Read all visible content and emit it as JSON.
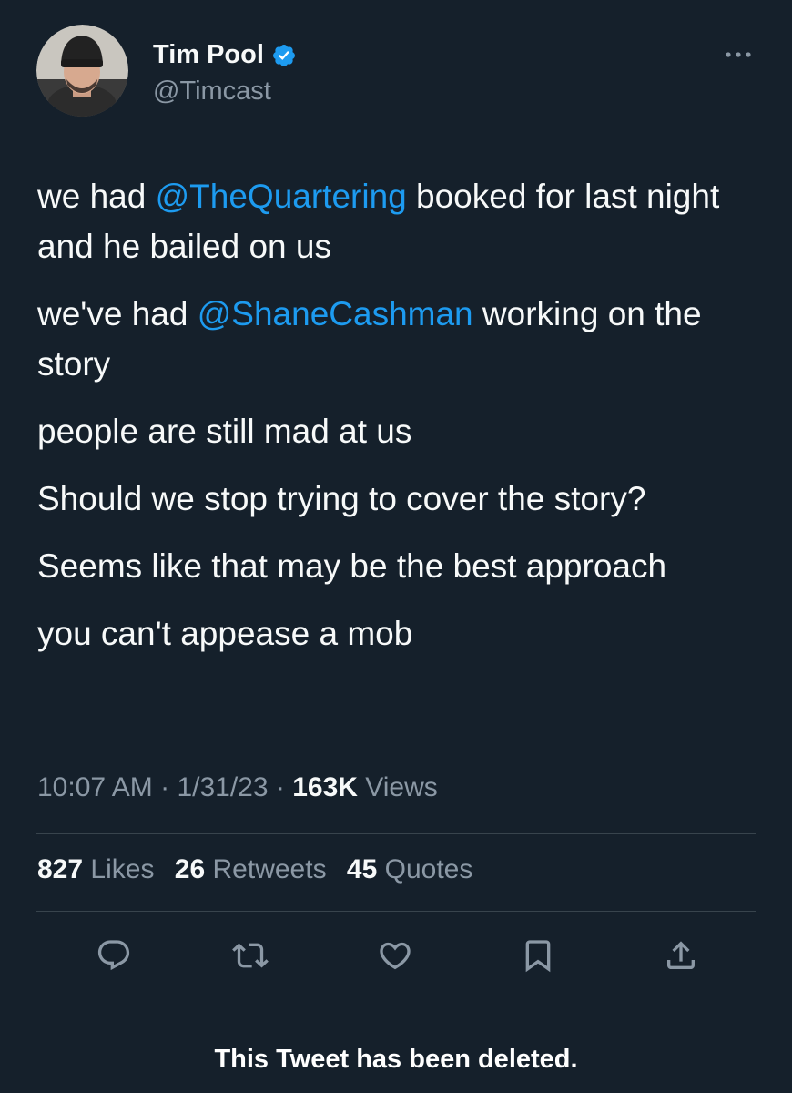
{
  "user": {
    "display_name": "Tim Pool",
    "handle": "@Timcast",
    "verified": true
  },
  "tweet": {
    "paragraphs": [
      {
        "parts": [
          {
            "text": "we had ",
            "type": "text"
          },
          {
            "text": "@TheQuartering",
            "type": "mention"
          },
          {
            "text": " booked for last night and he bailed on us",
            "type": "text"
          }
        ]
      },
      {
        "parts": [
          {
            "text": "we've had ",
            "type": "text"
          },
          {
            "text": "@ShaneCashman",
            "type": "mention"
          },
          {
            "text": " working on the story",
            "type": "text"
          }
        ]
      },
      {
        "parts": [
          {
            "text": "people are still mad at us",
            "type": "text"
          }
        ]
      },
      {
        "parts": [
          {
            "text": "Should we stop trying to cover the story?",
            "type": "text"
          }
        ]
      },
      {
        "parts": [
          {
            "text": "Seems like that may be the best approach",
            "type": "text"
          }
        ]
      },
      {
        "parts": [
          {
            "text": "you can't appease a mob",
            "type": "text"
          }
        ]
      }
    ],
    "time": "10:07 AM",
    "date": "1/31/23",
    "views_count": "163K",
    "views_label": "Views",
    "separator": "·"
  },
  "stats": {
    "likes_count": "827",
    "likes_label": "Likes",
    "retweets_count": "26",
    "retweets_label": "Retweets",
    "quotes_count": "45",
    "quotes_label": "Quotes"
  },
  "actions": [
    "reply-icon",
    "retweet-icon",
    "like-icon",
    "bookmark-icon",
    "share-icon"
  ],
  "notice": "This Tweet has been deleted.",
  "colors": {
    "background": "#15202b",
    "text": "#f7f9f9",
    "secondary": "#8b98a5",
    "accent": "#1d9bf0",
    "divider": "#38444d"
  }
}
